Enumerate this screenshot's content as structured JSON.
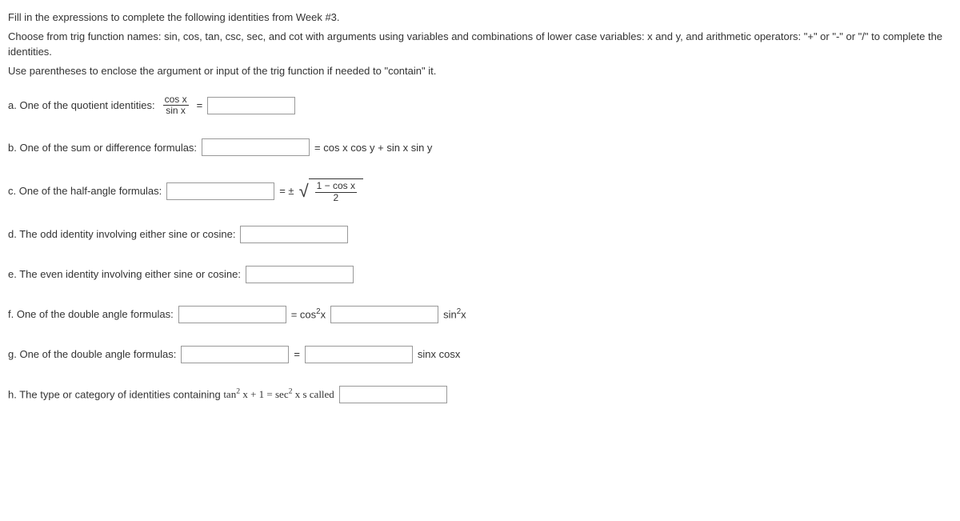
{
  "intro": {
    "line1": "Fill in the expressions to complete the following identities from Week #3.",
    "line2": "Choose from trig function names:  sin, cos, tan, csc, sec, and cot with arguments using variables and combinations of lower case variables: x and y, and arithmetic operators:  \"+\"  or \"-\" or \"/\"  to complete the identities.",
    "line3": "Use parentheses to enclose the argument or input of the trig function if needed to \"contain\" it."
  },
  "q_a": {
    "label": "a. One of the quotient identities:",
    "frac_num": "cos x",
    "frac_den": "sin x",
    "eq": "="
  },
  "q_b": {
    "label": "b.  One of the sum or difference formulas:",
    "rhs": "= cos x cos y + sin x sin y"
  },
  "q_c": {
    "label": "c.  One of the half-angle formulas:",
    "eq": "= ±",
    "frac_num": "1 − cos x",
    "frac_den": "2"
  },
  "q_d": {
    "label": "d.  The odd identity involving either sine or cosine:"
  },
  "q_e": {
    "label": "e.  The even identity involving either sine or cosine:"
  },
  "q_f": {
    "label": "f.  One of the double angle formulas:",
    "mid1": "= cos",
    "mid1_sup": "2",
    "mid1_after": "x",
    "mid2": "sin",
    "mid2_sup": "2",
    "mid2_after": "x"
  },
  "q_g": {
    "label": "g.  One of the double angle formulas:",
    "eq": "=",
    "rhs": "sinx cosx"
  },
  "q_h": {
    "label_before": "h.  The type or category of identities containing  ",
    "expr_tan": "tan",
    "expr_sup": "2",
    "expr_mid": " x + 1 = sec",
    "expr_sup2": "2",
    "expr_after": " x  s called"
  }
}
